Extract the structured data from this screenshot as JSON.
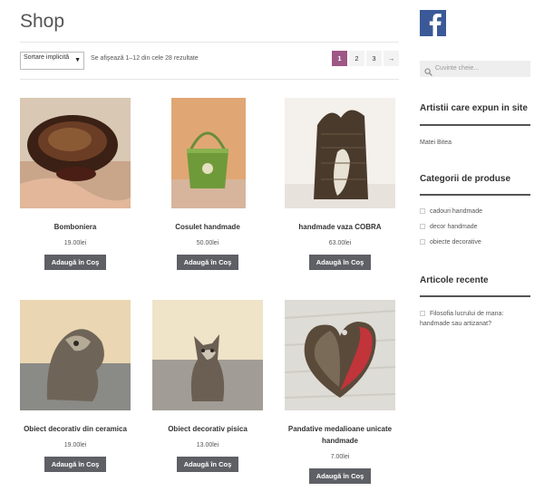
{
  "page": {
    "title": "Shop"
  },
  "toolbar": {
    "sort_value": "Sortare implicită",
    "result_count": "Se afişează 1–12 din cele 28 rezultate",
    "pages": [
      "1",
      "2",
      "3",
      "→"
    ],
    "current_page": "1"
  },
  "products": [
    {
      "title": "Bomboniera",
      "price": "19.00lei",
      "add_label": "Adaugă în Coş"
    },
    {
      "title": "Cosulet handmade",
      "price": "50.00lei",
      "add_label": "Adaugă în Coş"
    },
    {
      "title": "handmade vaza COBRA",
      "price": "63.00lei",
      "add_label": "Adaugă în Coş"
    },
    {
      "title": "Obiect decorativ din ceramica",
      "price": "19.00lei",
      "add_label": "Adaugă în Coş"
    },
    {
      "title": "Obiect decorativ pisica",
      "price": "13.00lei",
      "add_label": "Adaugă în Coş"
    },
    {
      "title": "Pandative medalioane unicate handmade",
      "price": "7.00lei",
      "add_label": "Adaugă în Coş"
    }
  ],
  "sidebar": {
    "search_placeholder": "Cuvinte cheie...",
    "artists_title": "Artistii care expun in site",
    "artists": [
      "Matei Bitea"
    ],
    "categories_title": "Categorii de produse",
    "categories": [
      "cadouri handmade",
      "decor handmade",
      "obiecte decorative"
    ],
    "recent_title": "Articole recente",
    "recent_posts": [
      "Filosofia lucrului de mana: handmade sau artizanat?"
    ]
  },
  "icons": {
    "facebook": "facebook-icon",
    "search": "search-icon",
    "page_next": "arrow-right-icon"
  },
  "colors": {
    "accent": "#9e5886",
    "button": "#5f6066",
    "facebook": "#3b5998"
  }
}
